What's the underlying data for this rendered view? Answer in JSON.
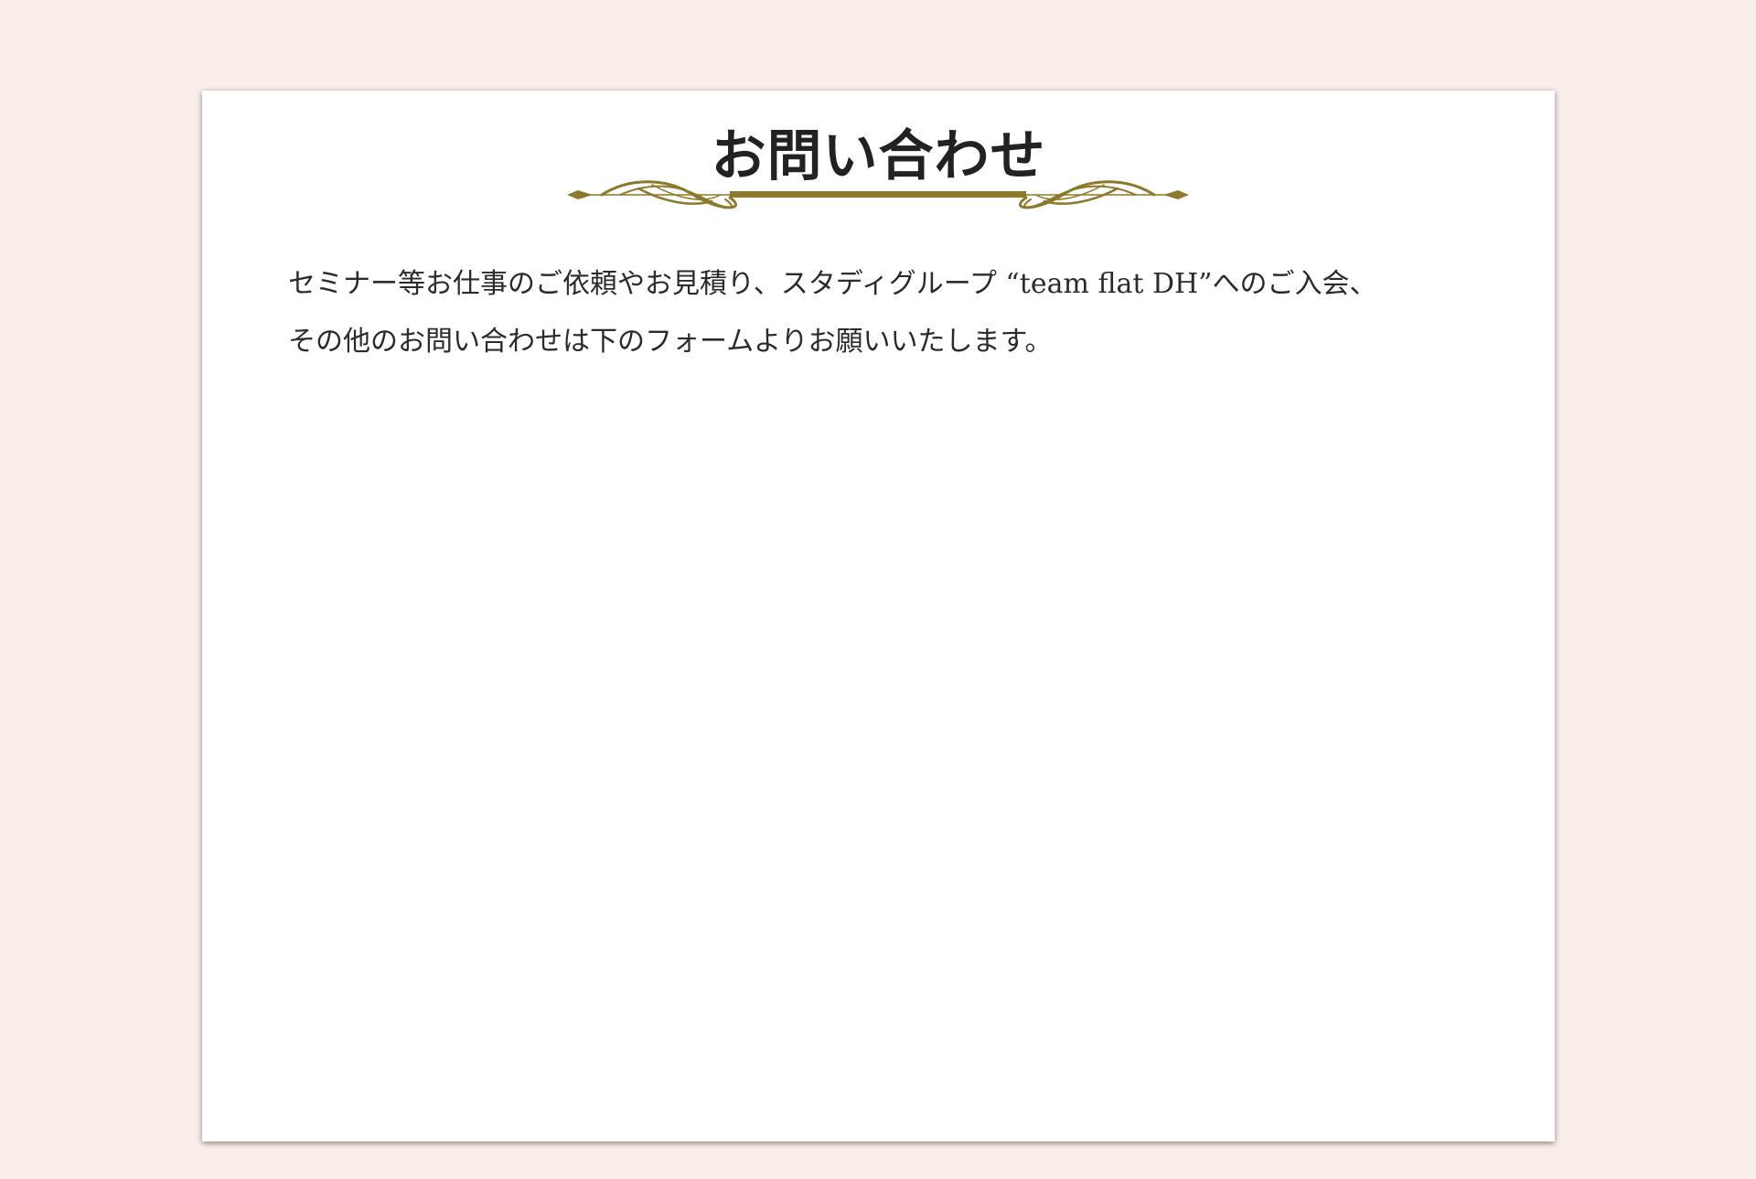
{
  "page": {
    "title": "お問い合わせ",
    "ornament_icon": "gold-flourish-divider-icon",
    "intro": "セミナー等お仕事のご依頼やお見積り、スタディグループ “team flat DH”へのご入会、\nその他のお問い合わせは下のフォームよりお願いいたします。"
  },
  "colors": {
    "page_background": "#f9eeea",
    "card_background": "#ffffff",
    "text": "#2b2b2b",
    "accent_gold": "#8c7a2a"
  }
}
